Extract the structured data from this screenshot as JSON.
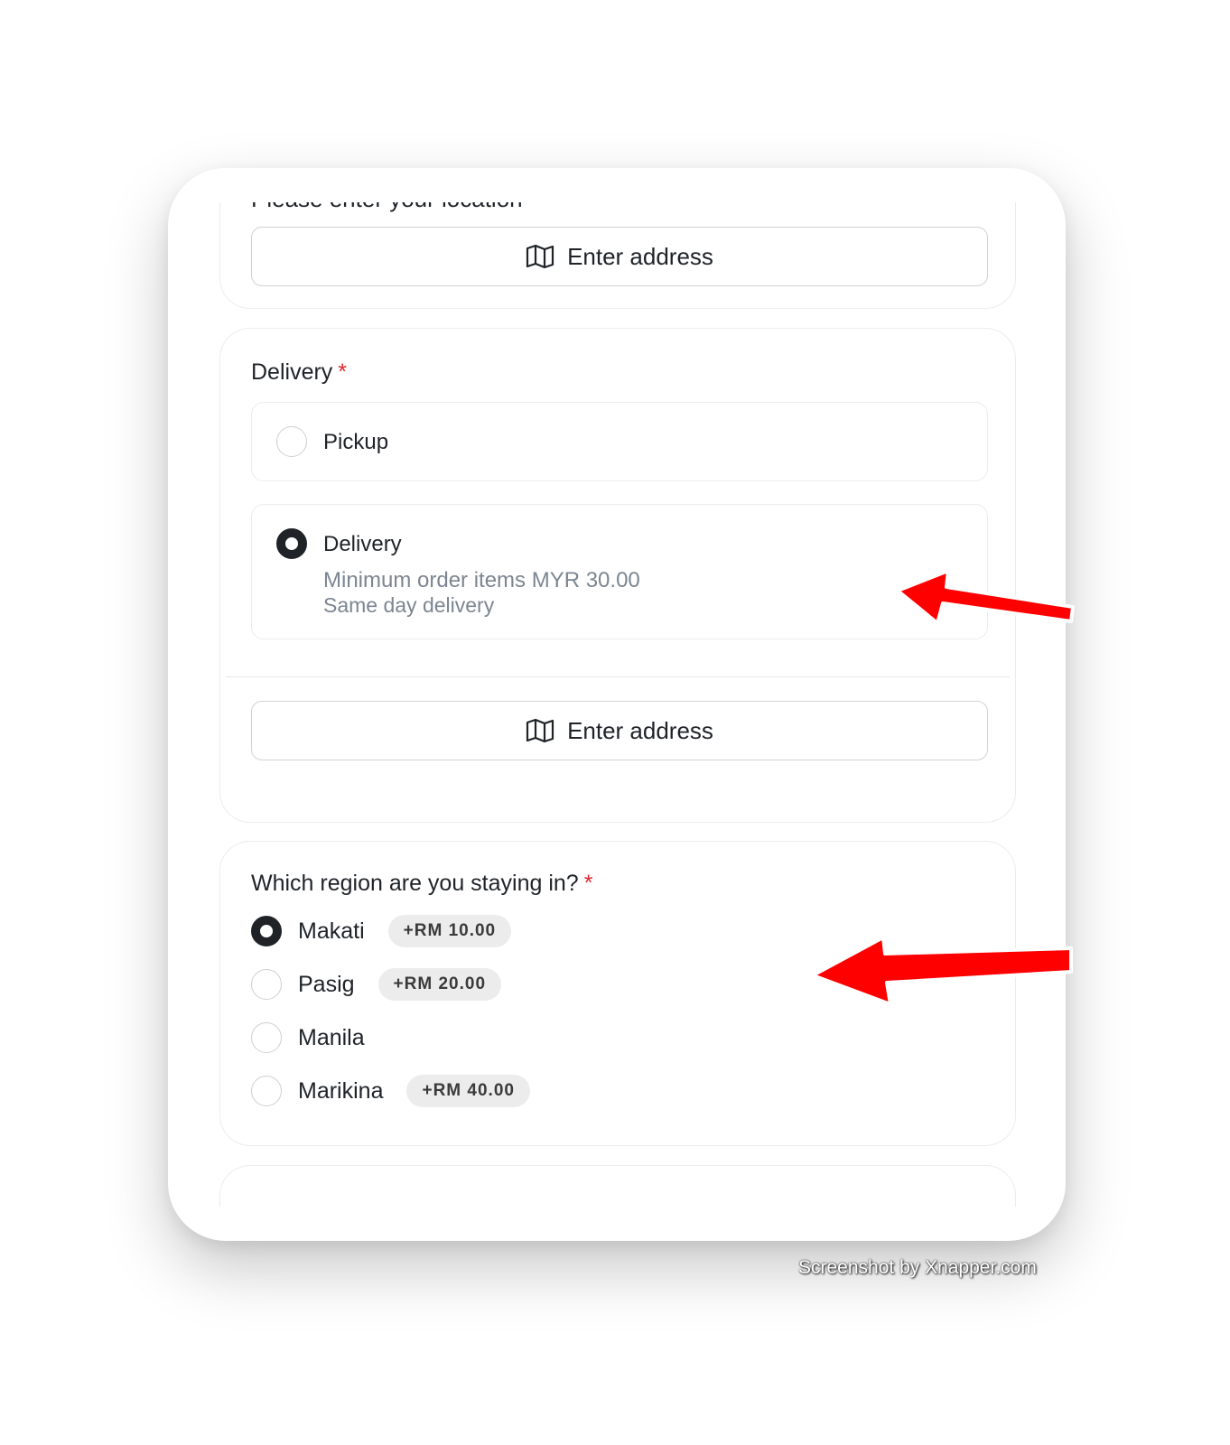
{
  "location_card": {
    "cut_label": "Please enter your location",
    "address_button": {
      "icon": "map-icon",
      "label": "Enter address"
    }
  },
  "delivery_card": {
    "label": "Delivery",
    "required_mark": "*",
    "options": [
      {
        "title": "Pickup",
        "selected": false
      },
      {
        "title": "Delivery",
        "selected": true,
        "desc_1": "Minimum order items MYR 30.00",
        "desc_2": "Same day delivery"
      }
    ],
    "address_button": {
      "icon": "map-icon",
      "label": "Enter address"
    }
  },
  "region_card": {
    "label": "Which region are you staying in?",
    "required_mark": "*",
    "options": [
      {
        "name": "Makati",
        "price": "+RM 10.00",
        "selected": true
      },
      {
        "name": "Pasig",
        "price": "+RM 20.00",
        "selected": false
      },
      {
        "name": "Manila",
        "price": "",
        "selected": false
      },
      {
        "name": "Marikina",
        "price": "+RM 40.00",
        "selected": false
      }
    ]
  },
  "annotations": {
    "arrow_color": "#ff0000"
  },
  "colors": {
    "required": "#e5252a",
    "muted_text": "#7c8691",
    "badge_bg": "#ececec"
  },
  "watermark": "Screenshot by Xnapper.com"
}
